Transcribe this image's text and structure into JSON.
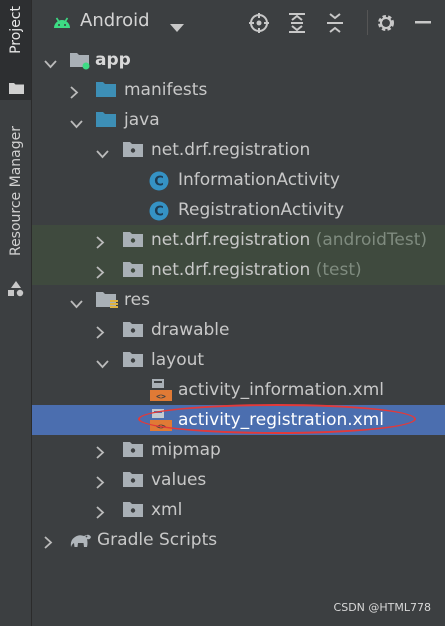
{
  "side_tabs": {
    "project": "Project",
    "resource_manager": "Resource Manager"
  },
  "toolbar": {
    "title": "Android",
    "buttons": [
      "locate-icon",
      "expand-all-icon",
      "collapse-all-icon",
      "gear-icon",
      "minimize-icon"
    ]
  },
  "tree": {
    "app": "app",
    "manifests": "manifests",
    "java": "java",
    "pkg_main": "net.drf.registration",
    "information_activity": "InformationActivity",
    "registration_activity": "RegistrationActivity",
    "pkg_android_test": "net.drf.registration",
    "pkg_android_test_suffix": "(androidTest)",
    "pkg_test": "net.drf.registration",
    "pkg_test_suffix": "(test)",
    "res": "res",
    "drawable": "drawable",
    "layout": "layout",
    "activity_information": "activity_information.xml",
    "activity_registration": "activity_registration.xml",
    "mipmap": "mipmap",
    "values": "values",
    "xml": "xml",
    "gradle_scripts": "Gradle Scripts"
  },
  "watermark": "CSDN @HTML778",
  "colors": {
    "selection": "#4b6eaf",
    "shaded_row": "#3f4a3e",
    "annotation": "#e23a3a",
    "android_green": "#3ddc84",
    "folder_blue": "#3d8fb6",
    "class_badge": "#3592c4",
    "xml_orange": "#e07a35"
  }
}
